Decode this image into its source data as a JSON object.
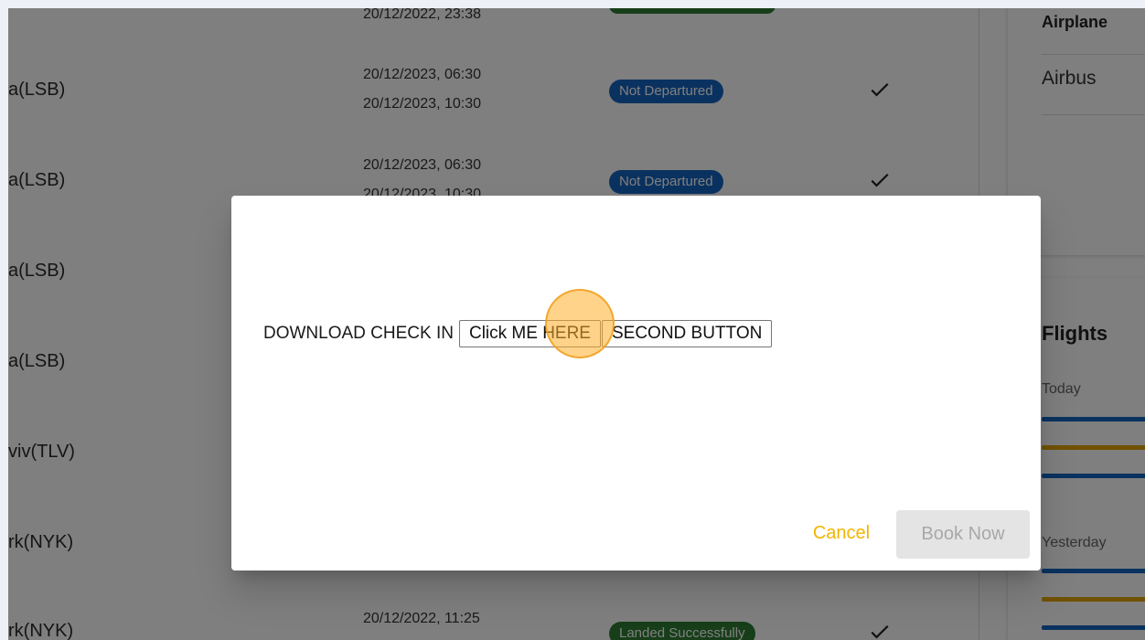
{
  "flights_table": {
    "rows": [
      {
        "city": "",
        "times": [
          "20/12/2022, 23:38"
        ],
        "status": "",
        "status_color": "#2e7d32"
      },
      {
        "city": "a(LSB)",
        "times": [
          "20/12/2023, 06:30",
          "20/12/2023, 10:30"
        ],
        "status": "Not Departured",
        "status_color": "#1565c0"
      },
      {
        "city": "a(LSB)",
        "times": [
          "20/12/2023, 06:30",
          "20/12/2023, 10:30"
        ],
        "status": "Not Departured",
        "status_color": "#1565c0"
      },
      {
        "city": "a(LSB)",
        "times": [],
        "status": "",
        "status_color": ""
      },
      {
        "city": "a(LSB)",
        "times": [],
        "status": "",
        "status_color": ""
      },
      {
        "city": "viv(TLV)",
        "times": [],
        "status": "",
        "status_color": ""
      },
      {
        "city": "rk(NYK)",
        "times": [],
        "status": "",
        "status_color": ""
      },
      {
        "city": "rk(NYK)",
        "times": [
          "20/12/2022, 11:25"
        ],
        "status": "Landed Successfully",
        "status_color": "#2e7d32"
      }
    ]
  },
  "side_panel": {
    "airplane_heading": "Airplane",
    "airplane_value": "Airbus",
    "flights_heading": "Flights",
    "today_label": "Today",
    "yesterday_label": "Yesterday"
  },
  "dialog": {
    "download_label": "DOWNLOAD CHECK IN",
    "click_me_label": "Click ME HERE",
    "second_button_label": "SECOND BUTTON",
    "cancel_label": "Cancel",
    "book_now_label": "Book Now"
  },
  "colors": {
    "accent": "#f4b400",
    "status_blue": "#1565c0",
    "status_green": "#2e7d32",
    "highlight": "#ffaf28"
  },
  "icons": {
    "check": "check-icon"
  }
}
